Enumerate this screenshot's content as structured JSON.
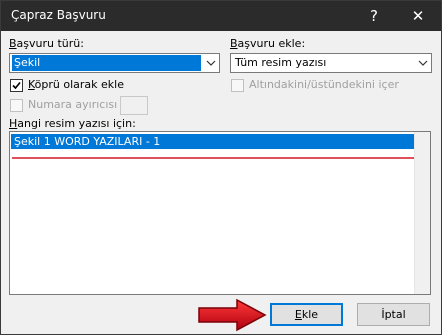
{
  "window": {
    "title": "Çapraz Başvuru",
    "help": "?",
    "close": "✕"
  },
  "ref_type": {
    "label_first": "B",
    "label_rest": "aşvuru türü:",
    "value": "Şekil"
  },
  "ref_to": {
    "label_first": "B",
    "label_rest": "aşvuru ekle:",
    "value": "Tüm resim yazısı"
  },
  "options": {
    "hyperlink_first": "K",
    "hyperlink_rest": "öprü olarak ekle",
    "hyperlink_checked": true,
    "above_below": "Altındakini/üstündekini içer",
    "separator": "Numara ayırıcısı"
  },
  "caption_list": {
    "label_first": "H",
    "label_rest": "angi resim yazısı için:",
    "items": [
      "Şekil 1 WORD YAZILARI - 1"
    ]
  },
  "buttons": {
    "insert_first": "E",
    "insert_rest": "kle",
    "cancel": "İptal"
  },
  "colors": {
    "selection": "#0078d7",
    "arrow": "#e8141e",
    "title_bar": "#2b2b2b"
  }
}
